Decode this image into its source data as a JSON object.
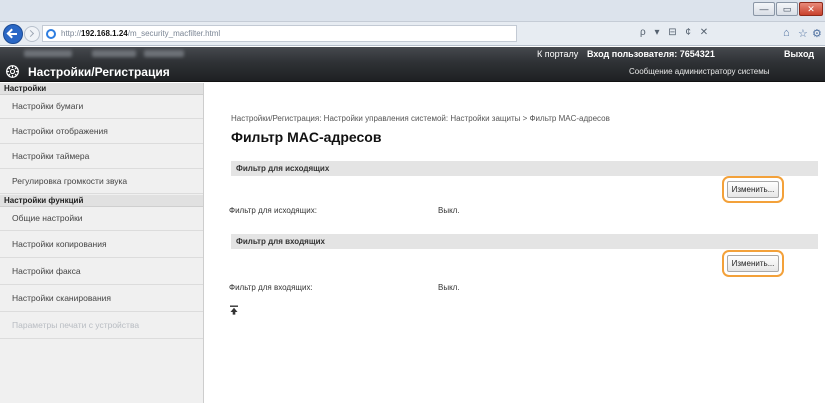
{
  "browser": {
    "url_prefix": "http://",
    "url_host": "192.168.1.24",
    "url_path": "/m_security_macfilter.html",
    "window_controls": {
      "minimize": "—",
      "maximize": "▭",
      "close": "✕"
    },
    "address_tools": "ρ ▾ ⊟ ¢ ✕"
  },
  "topbar": {
    "portal_link": "К порталу",
    "login_label": "Вход пользователя:",
    "login_id": "7654321",
    "logout_link": "Выход"
  },
  "appbar": {
    "title": "Настройки/Регистрация",
    "admin_message": "Сообщение администратору системы"
  },
  "sidebar": {
    "group_settings": "Настройки",
    "settings_items": [
      "Настройки бумаги",
      "Настройки отображения",
      "Настройки таймера",
      "Регулировка громкости звука"
    ],
    "group_functions": "Настройки функций",
    "function_items": [
      "Общие настройки",
      "Настройки копирования",
      "Настройки факса",
      "Настройки сканирования",
      "Параметры печати с устройства"
    ]
  },
  "main": {
    "breadcrumb": "Настройки/Регистрация: Настройки управления системой: Настройки защиты > Фильтр MAC-адресов",
    "title": "Фильтр MAC-адресов",
    "outgoing": {
      "header": "Фильтр для исходящих",
      "edit_label": "Изменить...",
      "row_label": "Фильтр для исходящих:",
      "row_value": "Выкл."
    },
    "incoming": {
      "header": "Фильтр для входящих",
      "edit_label": "Изменить...",
      "row_label": "Фильтр для входящих:",
      "row_value": "Выкл."
    }
  },
  "colors": {
    "highlight": "#f3a13a",
    "appbar": "#2f3236",
    "sidebar": "#f0f0f0",
    "section_header": "#e4e4e4"
  }
}
